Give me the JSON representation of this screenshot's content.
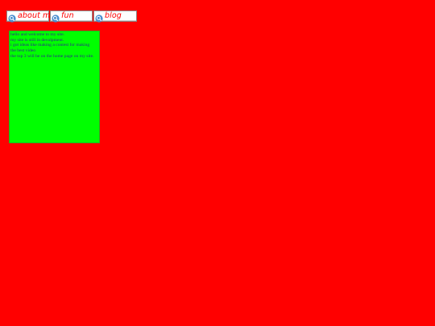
{
  "nav": {
    "buttons": [
      {
        "label": "about me",
        "icon": "search-icon"
      },
      {
        "label": "fun",
        "icon": "search-icon"
      },
      {
        "label": "blog",
        "icon": "search-icon"
      }
    ]
  },
  "content": {
    "lines": [
      "hello and welcome to my site.",
      "my site is still in devolpment.",
      "i got ideas like making a contest for making",
      "the best video",
      "the top 3 will be on the home page on my site."
    ]
  },
  "colors": {
    "page_background": "#ff0000",
    "content_background": "#00ff00",
    "content_text": "#2a2a8a",
    "nav_label": "#ff0000"
  }
}
